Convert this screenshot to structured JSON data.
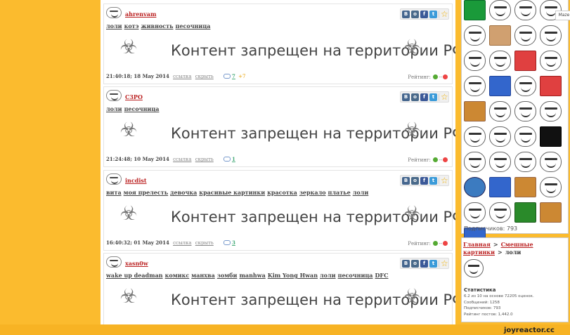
{
  "blocked_text": "Контент запрещен на территории РФ",
  "posts": [
    {
      "user": "ahrenvam",
      "tags": [
        "лоли",
        "котэ",
        "живность",
        "песочница"
      ],
      "date": "21:40:18; 18 May 2014",
      "link": "ссылка",
      "hide": "скрыть",
      "comments": "7",
      "new_comments": "+7",
      "rating_label": "Рейтинг:",
      "rating_value": "--"
    },
    {
      "user": "C3PO",
      "tags": [
        "лоли",
        "песочница"
      ],
      "date": "21:24:48; 10 May 2014",
      "link": "ссылка",
      "hide": "скрыть",
      "comments": "1",
      "new_comments": "",
      "rating_label": "Рейтинг:",
      "rating_value": "--"
    },
    {
      "user": "incdist",
      "tags": [
        "вита",
        "моя прелесть",
        "девочка",
        "красивые картинки",
        "красотка",
        "зеркало",
        "платье",
        "лоли"
      ],
      "date": "16:40:32; 01 May 2014",
      "link": "ссылка",
      "hide": "скрыть",
      "comments": "3",
      "new_comments": "",
      "rating_label": "Рейтинг:",
      "rating_value": "--"
    },
    {
      "user": "xasn0w",
      "tags": [
        "wake up deadman",
        "комикс",
        "манхва",
        "зомби",
        "manhwa",
        "Kim Yong Hwan",
        "лоли",
        "песочница",
        "DFC"
      ],
      "date": "",
      "link": "",
      "hide": "",
      "comments": "",
      "new_comments": "",
      "rating_label": "",
      "rating_value": ""
    }
  ],
  "share_icons": [
    "vk-icon",
    "odnoklassniki-icon",
    "facebook-icon",
    "twitter-icon",
    "favorite-star-icon"
  ],
  "sidebar": {
    "subscribers_label": "Подписчиков: 793",
    "tooltip": "Maze",
    "breadcrumb": [
      "Главная",
      "Смешные картинки",
      "лоли"
    ],
    "stats_title": "Статистика",
    "stats": [
      "6.2 из 10 на основе 72205 оценок.",
      "Сообщений: 1258",
      "Подписчиков: 793",
      "Рейтинг постов: 1,442.0"
    ]
  },
  "brand": "joyreactor.cc",
  "colors": {
    "background": "#fbbb2e",
    "username": "#bb2222",
    "rating_up": "#55aa33",
    "rating_down": "#ee4444"
  }
}
